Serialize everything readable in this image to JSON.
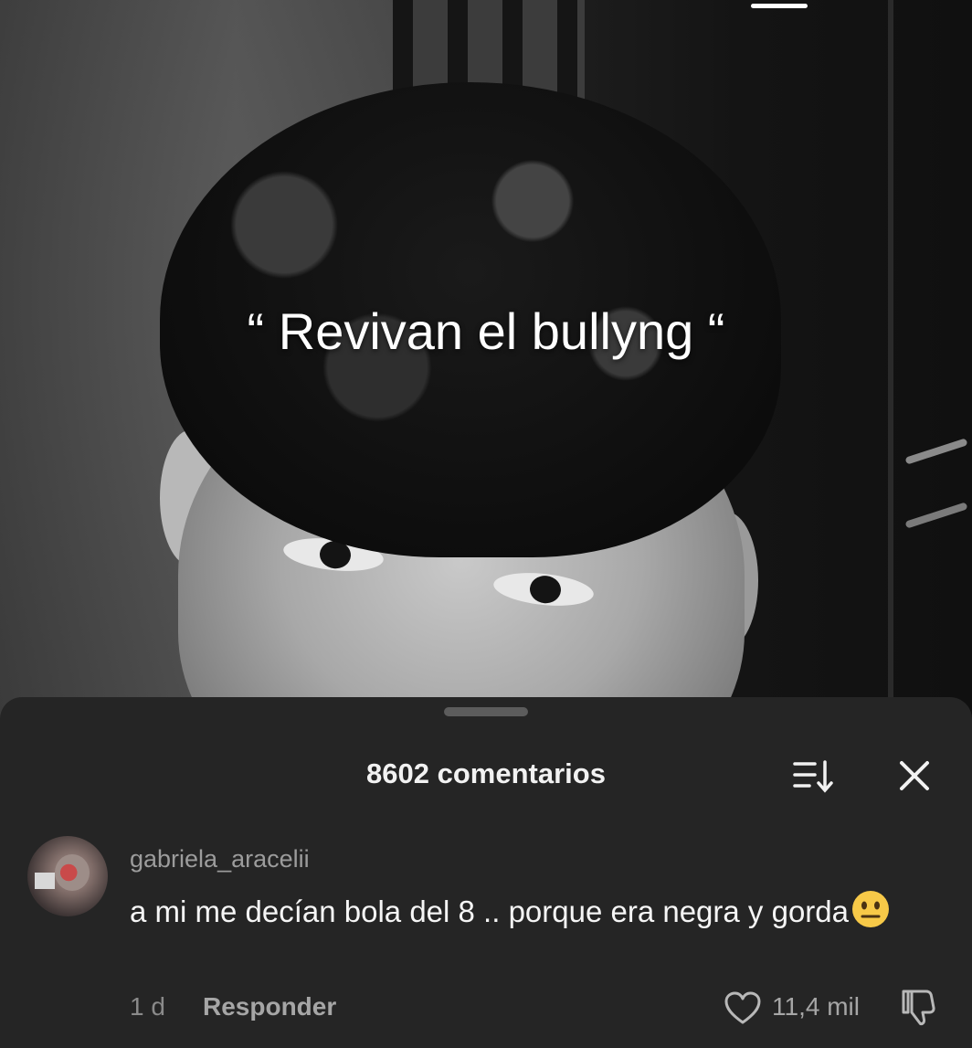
{
  "video": {
    "caption": "“ Revivan el bullyng “"
  },
  "comments_panel": {
    "title": "8602 comentarios",
    "sort_icon": "sort-descending-icon",
    "close_icon": "close-icon",
    "comments": [
      {
        "username": "gabriela_aracelii",
        "text": "a mi me decían bola del 8 .. porque era negra y gorda",
        "emoji": "neutral-face-emoji",
        "age": "1 d",
        "reply_label": "Responder",
        "likes": "11,4 mil"
      }
    ]
  },
  "colors": {
    "sheet_bg": "#252525",
    "primary_text": "#f5f5f5",
    "secondary_text": "#9c9c9c"
  }
}
